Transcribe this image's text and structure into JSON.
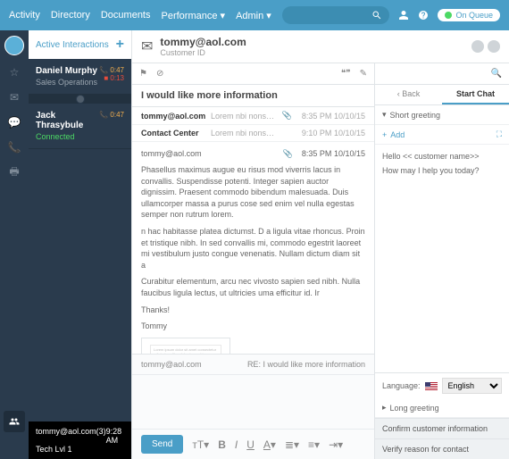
{
  "topnav": {
    "items": [
      "Activity",
      "Directory",
      "Documents",
      "Performance",
      "Admin"
    ],
    "on_queue": "On Queue"
  },
  "sidebar": {
    "title": "Active Interactions"
  },
  "interactions": [
    {
      "name": "Daniel Murphy",
      "sub": "Sales Operations",
      "t1": "0:47",
      "t2": "0:13"
    },
    {
      "name": "Jack Thrasybule",
      "sub": "Connected",
      "t1": "0:47"
    }
  ],
  "queue": {
    "line1": "tommy@aol.com(3)",
    "time": "9:28 AM",
    "line2": "Tech Lvl 1"
  },
  "customer": {
    "email": "tommy@aol.com",
    "label": "Customer ID"
  },
  "email": {
    "subject": "I would like more information",
    "rows": [
      {
        "from": "tommy@aol.com",
        "preview": "Lorem nbi nonsepittus…",
        "time": "8:35 PM",
        "date": "10/10/15"
      },
      {
        "from": "Contact Center",
        "preview": "Lorem nbi nonsepittus…",
        "time": "9:10 PM",
        "date": "10/10/15"
      }
    ],
    "open": {
      "from": "tommy@aol.com",
      "time": "8:35 PM",
      "date": "10/10/15",
      "p1": "Phasellus maximus augue eu risus mod viverris lacus in convallis. Suspendisse potenti. Integer sapien auctor dignissim. Praesent commodo bibendum malesuada. Duis ullamcorper massa a purus cose sed enim vel nulla egestas semper non rutrum lorem.",
      "p2": "n hac habitasse platea dictumst. D a ligula vitae rhoncus. Proin et tristique nibh. In sed convallis mi, commodo egestrit laoreet mi vestibulum justo congue venenatis. Nullam dictum diam sit a",
      "p3": "Curabitur elementum, arcu nec vivosto sapien sed nibh. Nulla faucibus ligula lectus, ut ultricies uma efficitur id. Ir",
      "p4": "Thanks!",
      "p5": "Tommy"
    },
    "reply": {
      "to": "tommy@aol.com",
      "re": "RE: I would like more information",
      "send": "Send"
    }
  },
  "script": {
    "back": "Back",
    "tab": "Start Chat",
    "short": "Short greeting",
    "add": "Add",
    "hello": "Hello << customer name>>",
    "help": "How may I help you today?",
    "lang_label": "Language:",
    "lang_value": "English",
    "long": "Long greeting",
    "confirm": "Confirm customer information",
    "verify": "Verify reason for contact"
  }
}
